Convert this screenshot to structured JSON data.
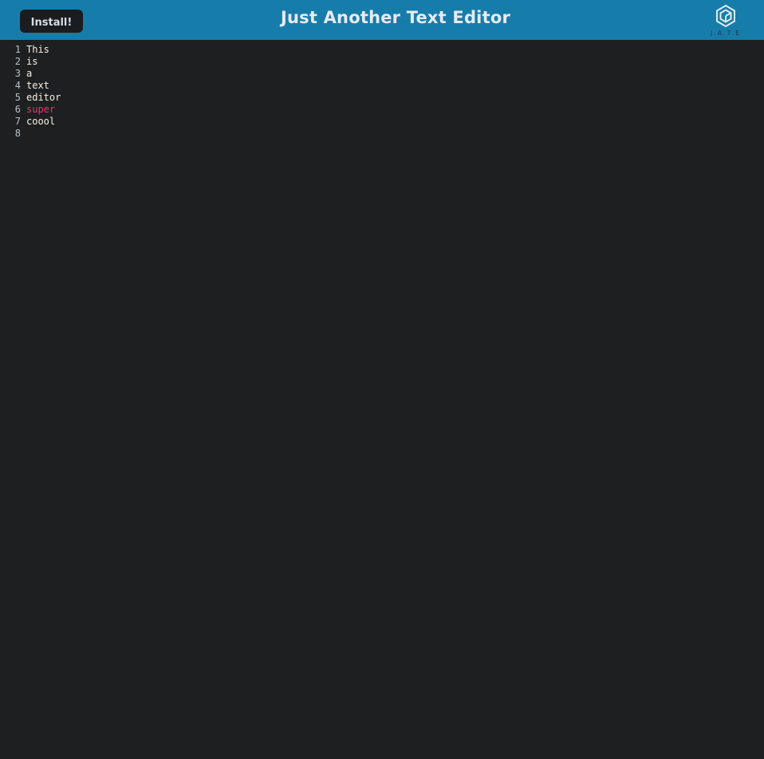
{
  "navbar": {
    "install_label": "Install!",
    "title": "Just Another Text Editor",
    "logo_text": "J.A.T.E",
    "logo_icon": "hexagon-logo-icon",
    "background": "#167dab"
  },
  "editor": {
    "background": "#1e1f21",
    "text_color": "#f5f2e0",
    "keyword_color": "#e8356a",
    "lines": [
      {
        "number": "1",
        "text": "This"
      },
      {
        "number": "2",
        "text": "is"
      },
      {
        "number": "3",
        "text": "a"
      },
      {
        "number": "4",
        "text": "text"
      },
      {
        "number": "5",
        "text": "editor"
      },
      {
        "number": "6",
        "text": "super"
      },
      {
        "number": "7",
        "text": "coool"
      },
      {
        "number": "8",
        "text": ""
      }
    ]
  }
}
